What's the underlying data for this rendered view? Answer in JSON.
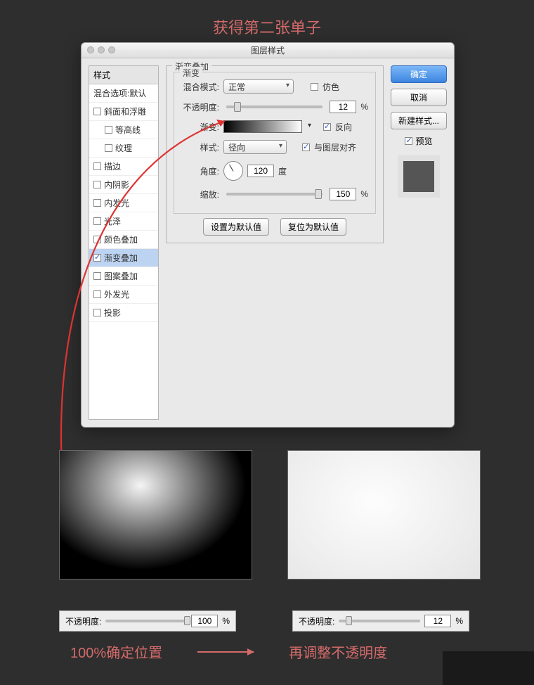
{
  "annotation": {
    "title": "获得第二张单子",
    "bottom_left": "100%确定位置",
    "bottom_right": "再调整不透明度"
  },
  "dialog": {
    "title": "图层样式",
    "sidebar": {
      "header": "样式",
      "blend_opts": "混合选项:默认",
      "items": [
        {
          "label": "斜面和浮雕",
          "checked": false,
          "sub": false
        },
        {
          "label": "等高线",
          "checked": false,
          "sub": true
        },
        {
          "label": "纹理",
          "checked": false,
          "sub": true
        },
        {
          "label": "描边",
          "checked": false,
          "sub": false
        },
        {
          "label": "内阴影",
          "checked": false,
          "sub": false
        },
        {
          "label": "内发光",
          "checked": false,
          "sub": false
        },
        {
          "label": "光泽",
          "checked": false,
          "sub": false
        },
        {
          "label": "颜色叠加",
          "checked": false,
          "sub": false
        },
        {
          "label": "渐变叠加",
          "checked": true,
          "sub": false,
          "selected": true
        },
        {
          "label": "图案叠加",
          "checked": false,
          "sub": false
        },
        {
          "label": "外发光",
          "checked": false,
          "sub": false
        },
        {
          "label": "投影",
          "checked": false,
          "sub": false
        }
      ]
    },
    "panel": {
      "group_title": "渐变叠加",
      "inner_title": "渐变",
      "blend_mode_label": "混合模式:",
      "blend_mode_value": "正常",
      "dither_label": "仿色",
      "dither_checked": false,
      "opacity_label": "不透明度:",
      "opacity_value": "12",
      "percent": "%",
      "gradient_label": "渐变:",
      "reverse_label": "反向",
      "reverse_checked": true,
      "style_label": "样式:",
      "style_value": "径向",
      "align_label": "与图层对齐",
      "align_checked": true,
      "angle_label": "角度:",
      "angle_value": "120",
      "angle_unit": "度",
      "scale_label": "缩放:",
      "scale_value": "150",
      "default_btn": "设置为默认值",
      "reset_btn": "复位为默认值"
    },
    "buttons": {
      "ok": "确定",
      "cancel": "取消",
      "new_style": "新建样式...",
      "preview": "预览",
      "preview_checked": true
    }
  },
  "bottom_bars": {
    "label": "不透明度:",
    "left_value": "100",
    "right_value": "12",
    "percent": "%"
  }
}
